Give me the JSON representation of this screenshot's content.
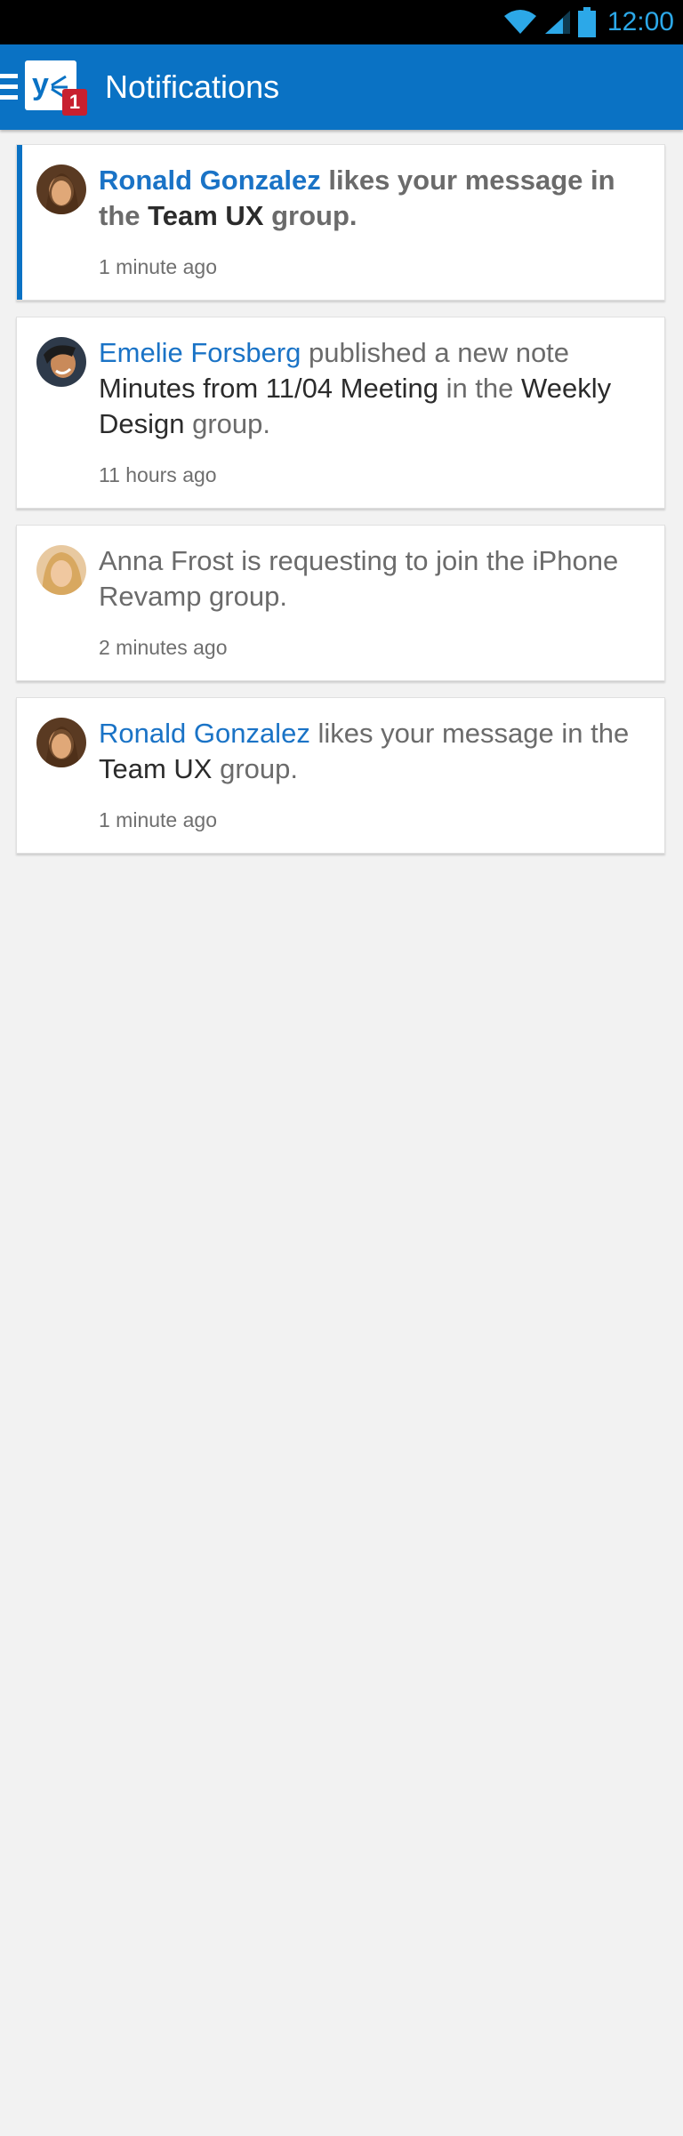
{
  "status_bar": {
    "time": "12:00"
  },
  "app_bar": {
    "title": "Notifications",
    "badge_count": "1"
  },
  "notifications": [
    {
      "actor": "Ronald Gonzalez",
      "text1": " likes your message in the ",
      "object": "Team UX",
      "text2": " group.",
      "time": "1 minute ago",
      "unread": true
    },
    {
      "actor": "Emelie Forsberg",
      "text1": " published a new note ",
      "object": "Minutes from 11/04 Meeting",
      "text2": " in the ",
      "object2": "Weekly Design",
      "text3": " group.",
      "time": "11 hours ago",
      "unread": false
    },
    {
      "text1": "Anna Frost is requesting to join the iPhone Revamp group.",
      "time": "2 minutes ago",
      "unread": false
    },
    {
      "actor": "Ronald Gonzalez",
      "text1": " likes your message in the ",
      "object": "Team UX",
      "text2": " group.",
      "time": "1 minute ago",
      "unread": false
    }
  ],
  "colors": {
    "accent": "#0a72c4",
    "badge": "#c8202f",
    "link": "#1a73c6"
  }
}
